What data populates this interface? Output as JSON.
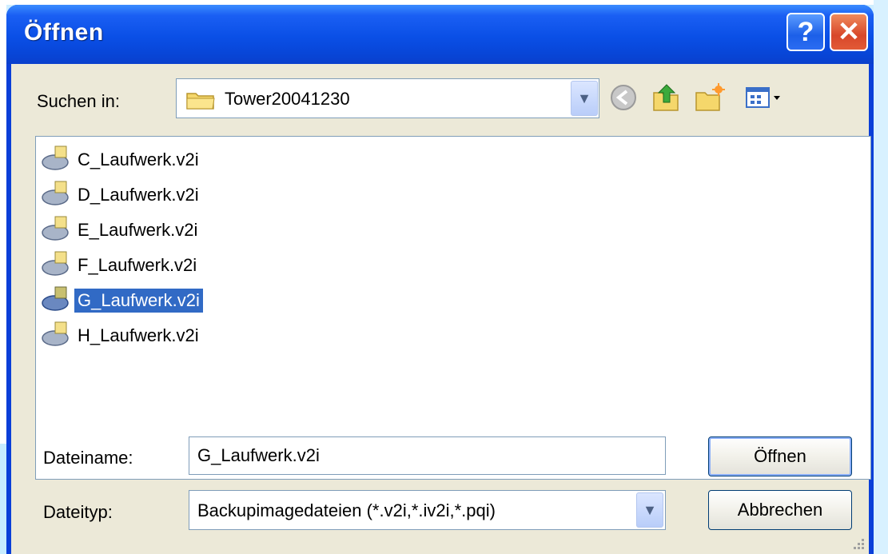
{
  "window": {
    "title": "Öffnen"
  },
  "titlebar_buttons": {
    "help": "?",
    "close": "✕"
  },
  "lookin": {
    "label": "Suchen in:",
    "value": "Tower20041230"
  },
  "toolbar": {
    "back": "back-icon",
    "up": "up-folder-icon",
    "new_folder": "new-folder-icon",
    "views": "view-menu-icon"
  },
  "files": [
    {
      "name": "C_Laufwerk.v2i",
      "selected": false
    },
    {
      "name": "D_Laufwerk.v2i",
      "selected": false
    },
    {
      "name": "E_Laufwerk.v2i",
      "selected": false
    },
    {
      "name": "F_Laufwerk.v2i",
      "selected": false
    },
    {
      "name": "G_Laufwerk.v2i",
      "selected": true
    },
    {
      "name": "H_Laufwerk.v2i",
      "selected": false
    }
  ],
  "filename": {
    "label": "Dateiname:",
    "value": "G_Laufwerk.v2i"
  },
  "filetype": {
    "label": "Dateityp:",
    "value": "Backupimagedateien (*.v2i,*.iv2i,*.pqi)"
  },
  "buttons": {
    "open": "Öffnen",
    "cancel": "Abbrechen"
  },
  "colors": {
    "selection": "#316ac5",
    "titlebar": "#0a4fe6",
    "client": "#ece9d8"
  }
}
